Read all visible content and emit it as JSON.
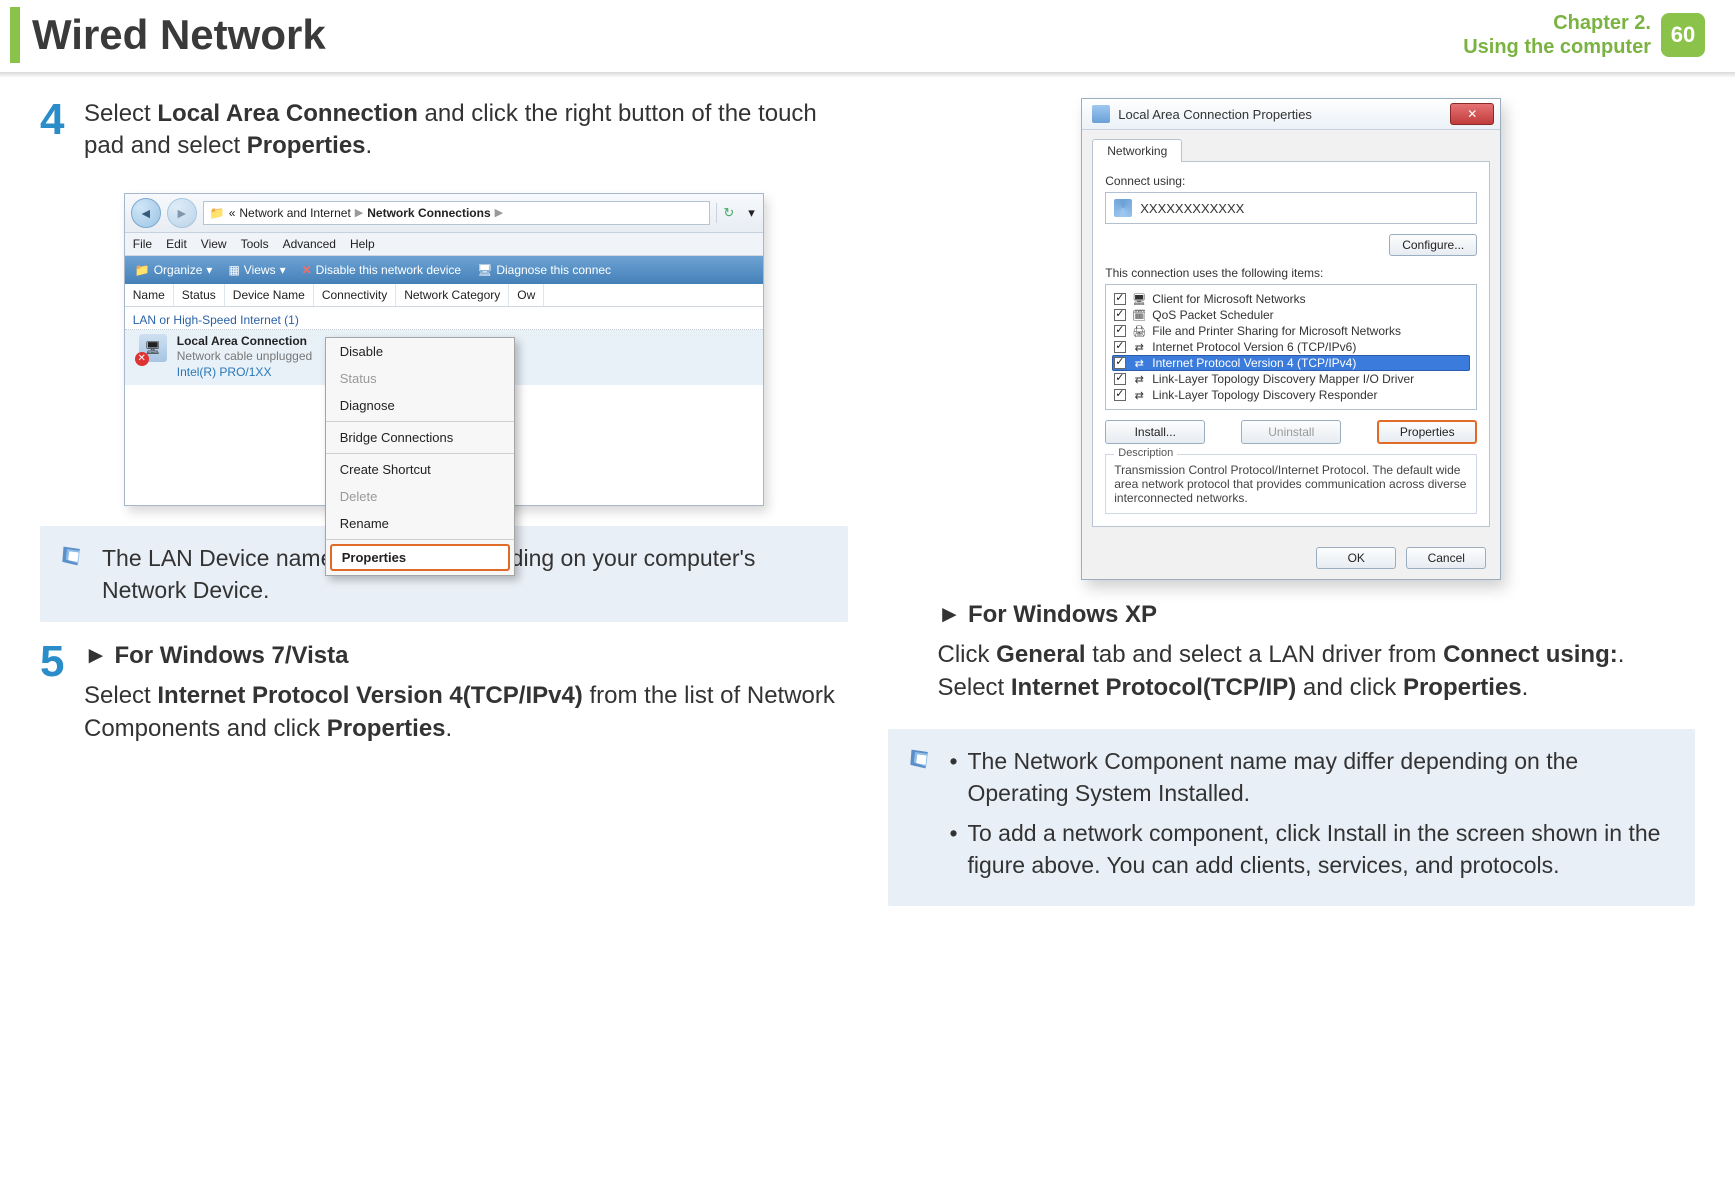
{
  "header": {
    "title": "Wired Network",
    "chapter_line1": "Chapter 2.",
    "chapter_line2": "Using the computer",
    "page_number": "60"
  },
  "step4": {
    "number": "4",
    "text_pre": "Select ",
    "text_b1": "Local Area Connection",
    "text_mid": " and click the right button of the touch pad and select ",
    "text_b2": "Properties",
    "text_post": "."
  },
  "net_window": {
    "breadcrumb_prefix": "«",
    "breadcrumb_p1": "Network and Internet",
    "breadcrumb_p2": "Network Connections",
    "menu": [
      "File",
      "Edit",
      "View",
      "Tools",
      "Advanced",
      "Help"
    ],
    "toolbar": {
      "organize": "Organize",
      "views": "Views",
      "disable": "Disable this network device",
      "diagnose": "Diagnose this connec"
    },
    "columns": [
      "Name",
      "Status",
      "Device Name",
      "Connectivity",
      "Network Category",
      "Ow"
    ],
    "group": "LAN or High-Speed Internet (1)",
    "connection": {
      "name": "Local Area Connection",
      "status": "Network cable unplugged",
      "device": "Intel(R) PRO/1XX"
    },
    "context": {
      "disable": "Disable",
      "status": "Status",
      "diagnose": "Diagnose",
      "bridge": "Bridge Connections",
      "shortcut": "Create Shortcut",
      "delete": "Delete",
      "rename": "Rename",
      "properties": "Properties"
    }
  },
  "note1": "The LAN Device name may differ depending on your computer's Network Device.",
  "step5": {
    "number": "5",
    "heading_arrow": "►",
    "heading": "For Windows 7/Vista",
    "line_pre": "Select ",
    "line_b1": "Internet Protocol Version 4(TCP/IPv4)",
    "line_mid": " from the list of Network Components and click ",
    "line_b2": "Properties",
    "line_post": "."
  },
  "props": {
    "title": "Local Area Connection Properties",
    "tab": "Networking",
    "connect_using_label": "Connect using:",
    "adapter": "XXXXXXXXXXXX",
    "configure": "Configure...",
    "items_label": "This connection uses the following items:",
    "items": [
      "Client for Microsoft Networks",
      "QoS Packet Scheduler",
      "File and Printer Sharing for Microsoft Networks",
      "Internet Protocol Version 6 (TCP/IPv6)",
      "Internet Protocol Version 4 (TCP/IPv4)",
      "Link-Layer Topology Discovery Mapper I/O Driver",
      "Link-Layer Topology Discovery Responder"
    ],
    "install": "Install...",
    "uninstall": "Uninstall",
    "properties": "Properties",
    "desc_label": "Description",
    "desc_text": "Transmission Control Protocol/Internet Protocol. The default wide area network protocol that provides communication across diverse interconnected networks.",
    "ok": "OK",
    "cancel": "Cancel"
  },
  "xp_section": {
    "arrow": "►",
    "heading": "For Windows XP",
    "line_pre": "Click ",
    "b1": "General",
    "mid1": " tab and select a LAN driver from ",
    "b2": "Connect using:",
    "mid2": ". Select ",
    "b3": "Internet Protocol(TCP/IP)",
    "mid3": " and click ",
    "b4": "Properties",
    "post": "."
  },
  "note2": {
    "bullet1": "The Network Component name may differ depending on the Operating System Installed.",
    "bullet2": "To add a network component, click Install in the screen shown in the figure above. You can add clients, services, and protocols."
  }
}
